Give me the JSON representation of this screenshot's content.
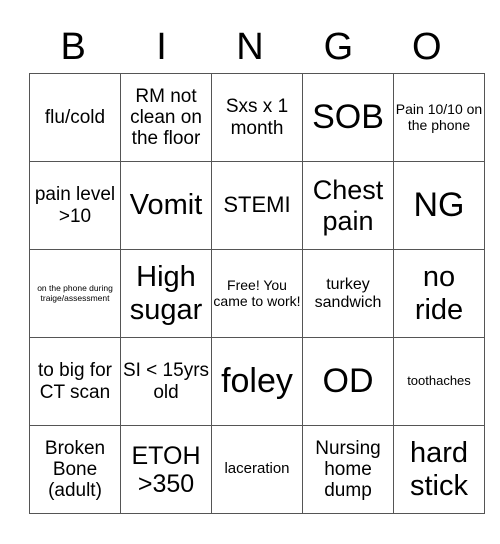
{
  "header": {
    "letters": [
      "B",
      "I",
      "N",
      "G",
      "O"
    ]
  },
  "board": {
    "rows": [
      [
        "flu/cold",
        "RM not clean on the floor",
        "Sxs x 1 month",
        "SOB",
        "Pain 10/10 on the phone"
      ],
      [
        "pain level >10",
        "Vomit",
        "STEMI",
        "Chest pain",
        "NG"
      ],
      [
        "on the phone during traige/assessment",
        "High sugar",
        "Free! You came to work!",
        "turkey sandwich",
        "no ride"
      ],
      [
        "to big for CT scan",
        "SI < 15yrs old",
        "foley",
        "OD",
        "toothaches"
      ],
      [
        "Broken Bone (adult)",
        "ETOH >350",
        "laceration",
        "Nursing home dump",
        "hard stick"
      ]
    ]
  }
}
